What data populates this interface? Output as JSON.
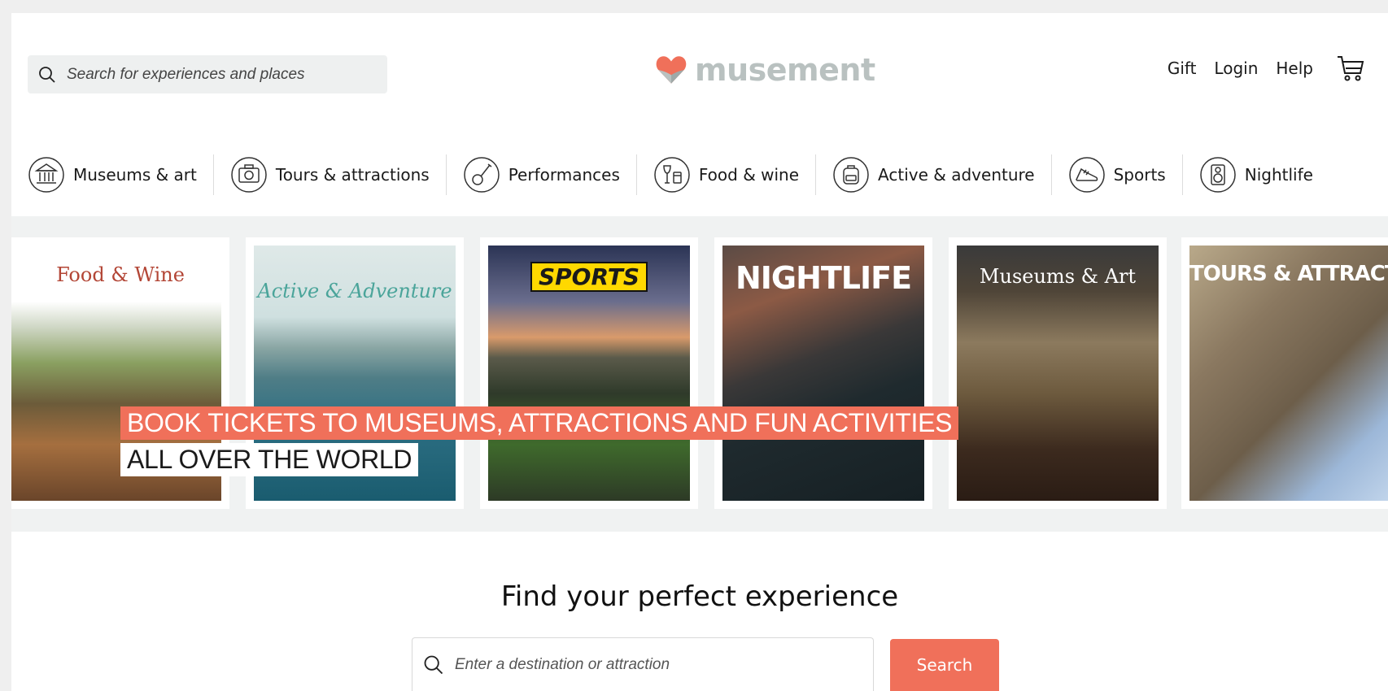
{
  "header": {
    "search_placeholder": "Search for experiences and places",
    "logo_text": "musement",
    "links": {
      "gift": "Gift",
      "login": "Login",
      "help": "Help"
    }
  },
  "categories": [
    {
      "label": "Museums & art",
      "icon": "museum-icon"
    },
    {
      "label": "Tours & attractions",
      "icon": "camera-icon"
    },
    {
      "label": "Performances",
      "icon": "guitar-icon"
    },
    {
      "label": "Food & wine",
      "icon": "food-wine-icon"
    },
    {
      "label": "Active & adventure",
      "icon": "backpack-icon"
    },
    {
      "label": "Sports",
      "icon": "sneaker-icon"
    },
    {
      "label": "Nightlife",
      "icon": "speaker-icon"
    }
  ],
  "banner": {
    "tiles": [
      {
        "label": "Food & Wine"
      },
      {
        "label": "Active & Adventure"
      },
      {
        "label": "SPORTS"
      },
      {
        "label": "NIGHTLIFE"
      },
      {
        "label": "Museums & Art"
      },
      {
        "label": "TOURS & ATTRACTIONS"
      }
    ],
    "headline_line1": "BOOK TICKETS TO MUSEUMS, ATTRACTIONS AND FUN ACTIVITIES",
    "headline_line2": "ALL OVER THE WORLD"
  },
  "find": {
    "title": "Find your perfect experience",
    "search_placeholder": "Enter a destination or attraction",
    "button_label": "Search"
  },
  "colors": {
    "accent": "#f0705a",
    "logo_heart": "#f0705a",
    "logo_text": "#b9c1c0"
  }
}
